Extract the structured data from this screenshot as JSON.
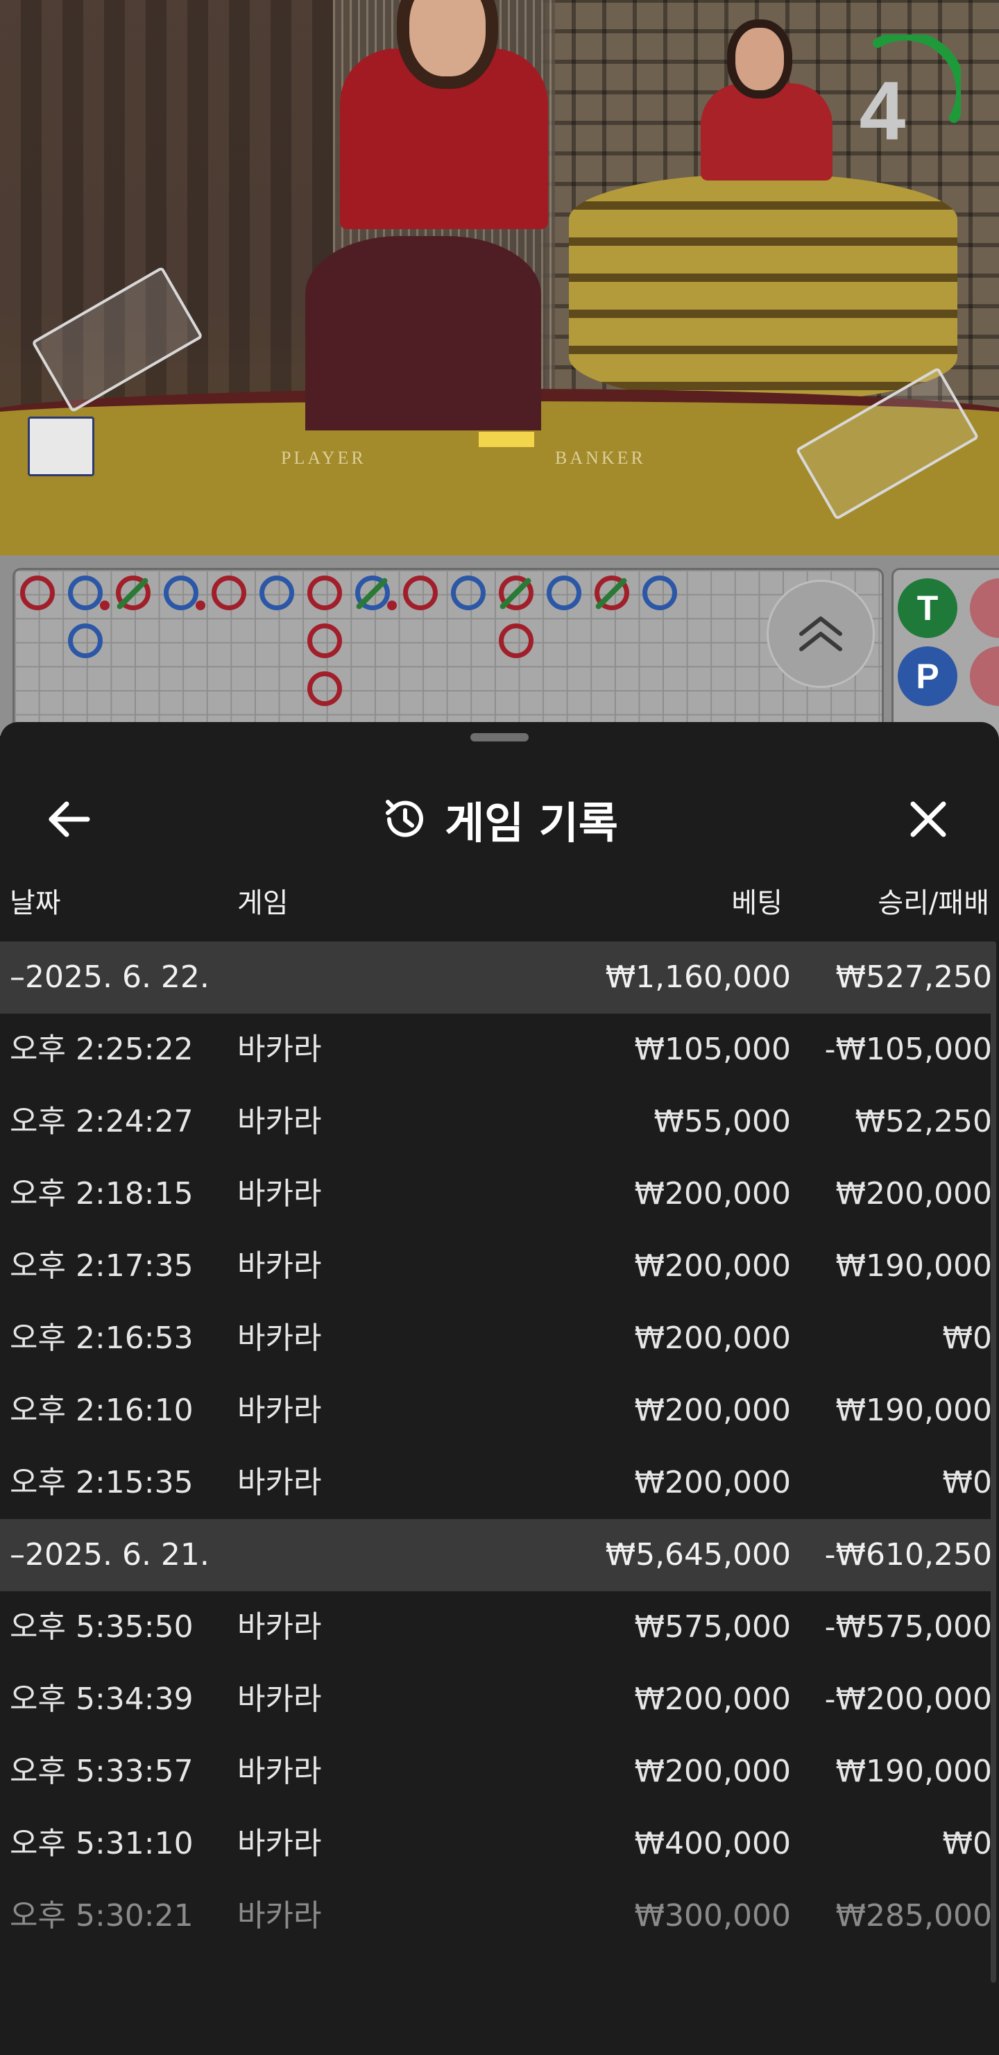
{
  "live_video": {
    "countdown": "4",
    "felt_left_label": "PLAYER",
    "felt_right_label": "BANKER",
    "timer_color": "#1f9a3a"
  },
  "roadmap": {
    "summary_badges": [
      {
        "letter": "T",
        "color": "#1f7a3a"
      },
      {
        "letter": "P",
        "color": "#2b57a6"
      }
    ],
    "collapse_icon": "chevron-double-up-icon"
  },
  "history": {
    "title": "게임 기록",
    "title_icon": "history-icon",
    "back_icon": "arrow-left-icon",
    "close_icon": "close-icon",
    "columns": {
      "date": "날짜",
      "game": "게임",
      "bet": "베팅",
      "result": "승리/패배"
    },
    "groups": [
      {
        "date": "–2025. 6. 22.",
        "bet_total": "₩1,160,000",
        "result_total": "₩527,250",
        "rows": [
          {
            "time": "오후 2:25:22",
            "game": "바카라",
            "bet": "₩105,000",
            "result": "-₩105,000"
          },
          {
            "time": "오후 2:24:27",
            "game": "바카라",
            "bet": "₩55,000",
            "result": "₩52,250"
          },
          {
            "time": "오후 2:18:15",
            "game": "바카라",
            "bet": "₩200,000",
            "result": "₩200,000"
          },
          {
            "time": "오후 2:17:35",
            "game": "바카라",
            "bet": "₩200,000",
            "result": "₩190,000"
          },
          {
            "time": "오후 2:16:53",
            "game": "바카라",
            "bet": "₩200,000",
            "result": "₩0"
          },
          {
            "time": "오후 2:16:10",
            "game": "바카라",
            "bet": "₩200,000",
            "result": "₩190,000"
          },
          {
            "time": "오후 2:15:35",
            "game": "바카라",
            "bet": "₩200,000",
            "result": "₩0"
          }
        ]
      },
      {
        "date": "–2025. 6. 21.",
        "bet_total": "₩5,645,000",
        "result_total": "-₩610,250",
        "rows": [
          {
            "time": "오후 5:35:50",
            "game": "바카라",
            "bet": "₩575,000",
            "result": "-₩575,000"
          },
          {
            "time": "오후 5:34:39",
            "game": "바카라",
            "bet": "₩200,000",
            "result": "-₩200,000"
          },
          {
            "time": "오후 5:33:57",
            "game": "바카라",
            "bet": "₩200,000",
            "result": "₩190,000"
          },
          {
            "time": "오후 5:31:10",
            "game": "바카라",
            "bet": "₩400,000",
            "result": "₩0"
          },
          {
            "time": "오후 5:30:21",
            "game": "바카라",
            "bet": "₩300,000",
            "result": "₩285,000"
          }
        ]
      }
    ]
  }
}
